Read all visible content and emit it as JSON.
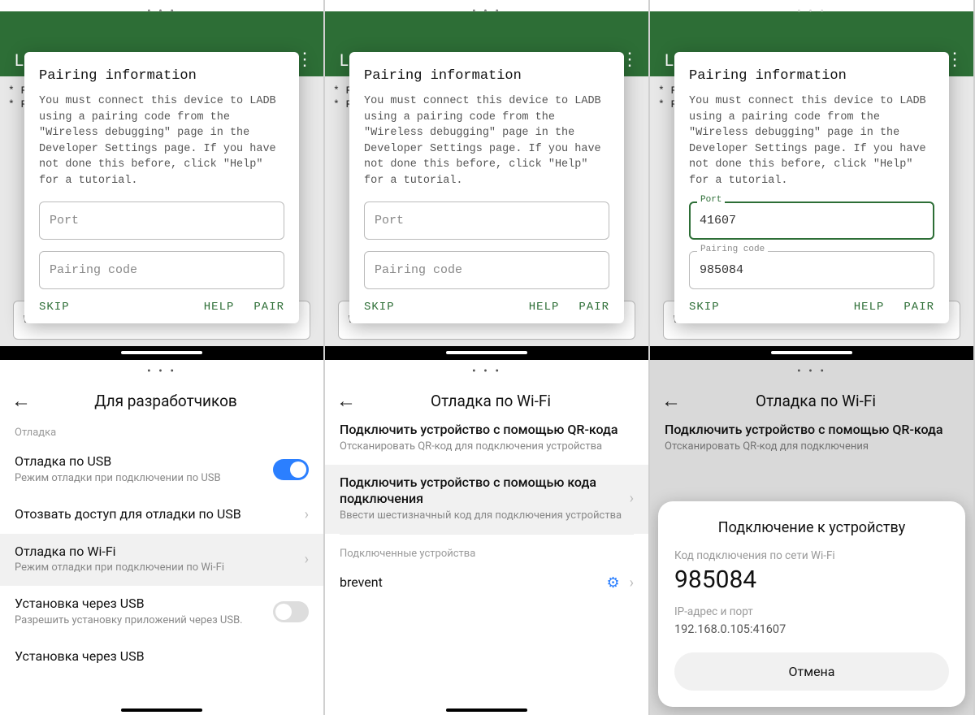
{
  "dialog": {
    "title": "Pairing information",
    "body": "You must connect this device to LADB using a pairing code from the \"Wireless debugging\" page in the Developer Settings page. If you have not done this before, click \"Help\" for a tutorial.",
    "port_label": "Port",
    "pairing_label": "Pairing code",
    "port_value": "41607",
    "pairing_value": "985084",
    "skip": "SKIP",
    "help": "HELP",
    "pair": "PAIR"
  },
  "app": {
    "title": "LA",
    "bg_line1": "* Re",
    "bg_line2": "* Re",
    "input_hint": "W"
  },
  "dev": {
    "title": "Для разработчиков",
    "section": "Отладка",
    "usb_debug_title": "Отладка по USB",
    "usb_debug_sub": "Режим отладки при подключении по USB",
    "revoke": "Отозвать доступ для отладки по USB",
    "wifi_debug_title": "Отладка по Wi-Fi",
    "wifi_debug_sub": "Режим отладки при подключении по Wi-Fi",
    "install_usb_title": "Установка через USB",
    "install_usb_sub": "Разрешить установку приложений через USB.",
    "install_usb2": "Установка через USB"
  },
  "wifi": {
    "title": "Отладка по Wi-Fi",
    "qr_title": "Подключить устройство с помощью QR-кода",
    "qr_sub": "Отсканировать QR-код для подключения устройства",
    "qr_sub_short": "Отсканировать QR-код для подключения",
    "code_title": "Подключить устройство с помощью кода подключения",
    "code_sub": "Ввести шестизначный код для подключения устройства",
    "connected_section": "Подключенные устройства",
    "device1": "brevent"
  },
  "sheet": {
    "title": "Подключение к устройству",
    "code_label": "Код подключения по сети Wi-Fi",
    "code": "985084",
    "ip_label": "IP-адрес и порт",
    "ip_value": "192.168.0.105:41607",
    "cancel": "Отмена"
  }
}
